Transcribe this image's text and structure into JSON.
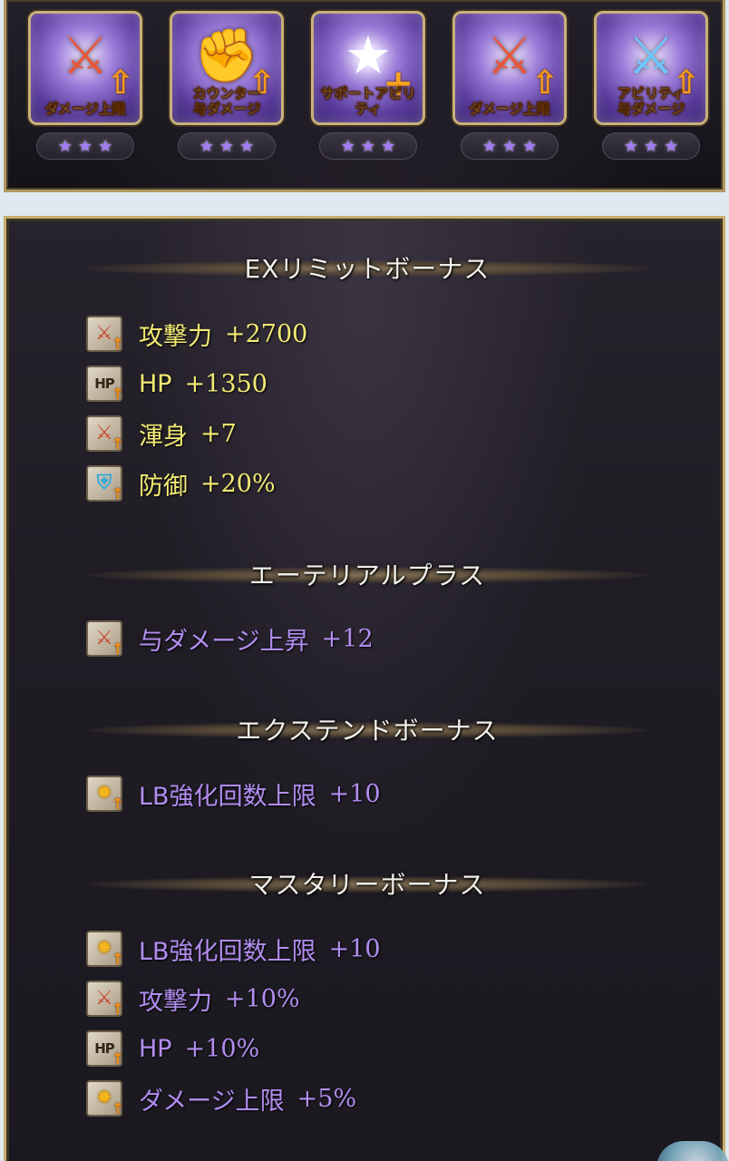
{
  "skills": [
    {
      "icon": "sword-icon",
      "caption": "ダメージ上限",
      "stars": 3
    },
    {
      "icon": "fist-icon",
      "caption": "カウンター\n与ダメージ",
      "stars": 3
    },
    {
      "icon": "star-icon",
      "caption": "サポートアビリティ",
      "stars": 3
    },
    {
      "icon": "sword-icon",
      "caption": "ダメージ上限",
      "stars": 3
    },
    {
      "icon": "blades-icon",
      "caption": "アビリティ\n与ダメージ",
      "stars": 3
    }
  ],
  "sections": {
    "ex_limit": {
      "title": "EXリミットボーナス",
      "rows": [
        {
          "icon": "attack-icon",
          "label": "攻撃力",
          "value": "+2700"
        },
        {
          "icon": "hp-icon",
          "label": "HP",
          "value": "+1350"
        },
        {
          "icon": "attack-icon",
          "label": "渾身",
          "value": "+7"
        },
        {
          "icon": "defense-icon",
          "label": "防御",
          "value": "+20%"
        }
      ]
    },
    "ethereal": {
      "title": "エーテリアルプラス",
      "rows": [
        {
          "icon": "attack-icon",
          "label": "与ダメージ上昇",
          "value": "+12"
        }
      ]
    },
    "extend": {
      "title": "エクステンドボーナス",
      "rows": [
        {
          "icon": "burst-icon",
          "label": "LB強化回数上限",
          "value": "+10"
        }
      ]
    },
    "mastery": {
      "title": "マスタリーボーナス",
      "rows": [
        {
          "icon": "burst-icon",
          "label": "LB強化回数上限",
          "value": "+10"
        },
        {
          "icon": "attack-icon",
          "label": "攻撃力",
          "value": "+10%"
        },
        {
          "icon": "hp-icon",
          "label": "HP",
          "value": "+10%"
        },
        {
          "icon": "burst-icon",
          "label": "ダメージ上限",
          "value": "+5%"
        }
      ]
    }
  },
  "icon_labels": {
    "hp": "HP"
  },
  "colors": {
    "bonus_yellow": "#f3ea74",
    "bonus_purple": "#b28df0",
    "frame_gold": "#c7ad6e",
    "upgrade_arrow": "#f2921a"
  }
}
